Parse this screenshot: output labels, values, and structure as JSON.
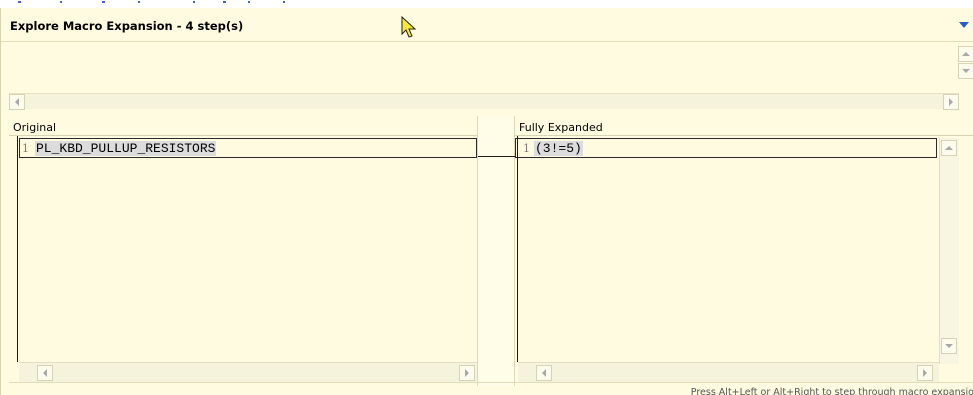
{
  "popup": {
    "title": "Explore Macro Expansion - 4 step(s)",
    "menu_icon": "chevron-down-icon"
  },
  "original": {
    "header": "Original",
    "lines": [
      {
        "number": "1",
        "text": "PL_KBD_PULLUP_RESISTORS"
      }
    ]
  },
  "expanded": {
    "header": "Fully Expanded",
    "lines": [
      {
        "number": "1",
        "text": "(3!=5)"
      }
    ]
  },
  "status": {
    "hint": "Press Alt+Left or Alt+Right to step through macro expansio"
  },
  "colors": {
    "background": "#fffbe0",
    "selection": "#dcdcdc",
    "menu_arrow": "#2b5bc7"
  }
}
